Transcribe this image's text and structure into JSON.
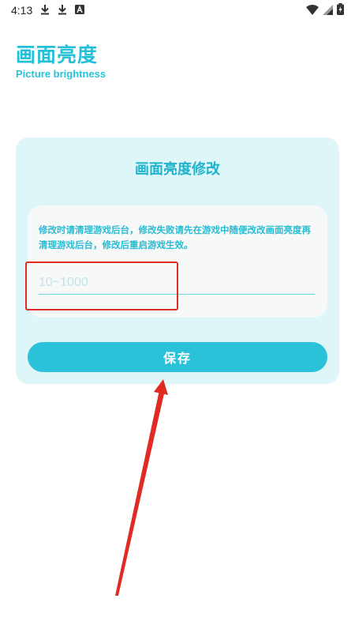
{
  "status_bar": {
    "time": "4:13",
    "left_icons": [
      "download-icon",
      "download-icon",
      "a-box-icon"
    ],
    "right_icons": [
      "wifi-icon",
      "signal-icon",
      "battery-icon"
    ]
  },
  "header": {
    "title": "画面亮度",
    "subtitle": "Picture brightness"
  },
  "card": {
    "title": "画面亮度修改",
    "notice": "修改时请清理游戏后台，修改失败请先在游戏中随便改改画面亮度再清理游戏后台，修改后重启游戏生效。",
    "input": {
      "value": "",
      "placeholder": "10~1000"
    },
    "save_label": "保存"
  },
  "colors": {
    "accent": "#2ac2d8",
    "card_bg": "#dff6f9",
    "annotation_red": "#e02a24"
  }
}
